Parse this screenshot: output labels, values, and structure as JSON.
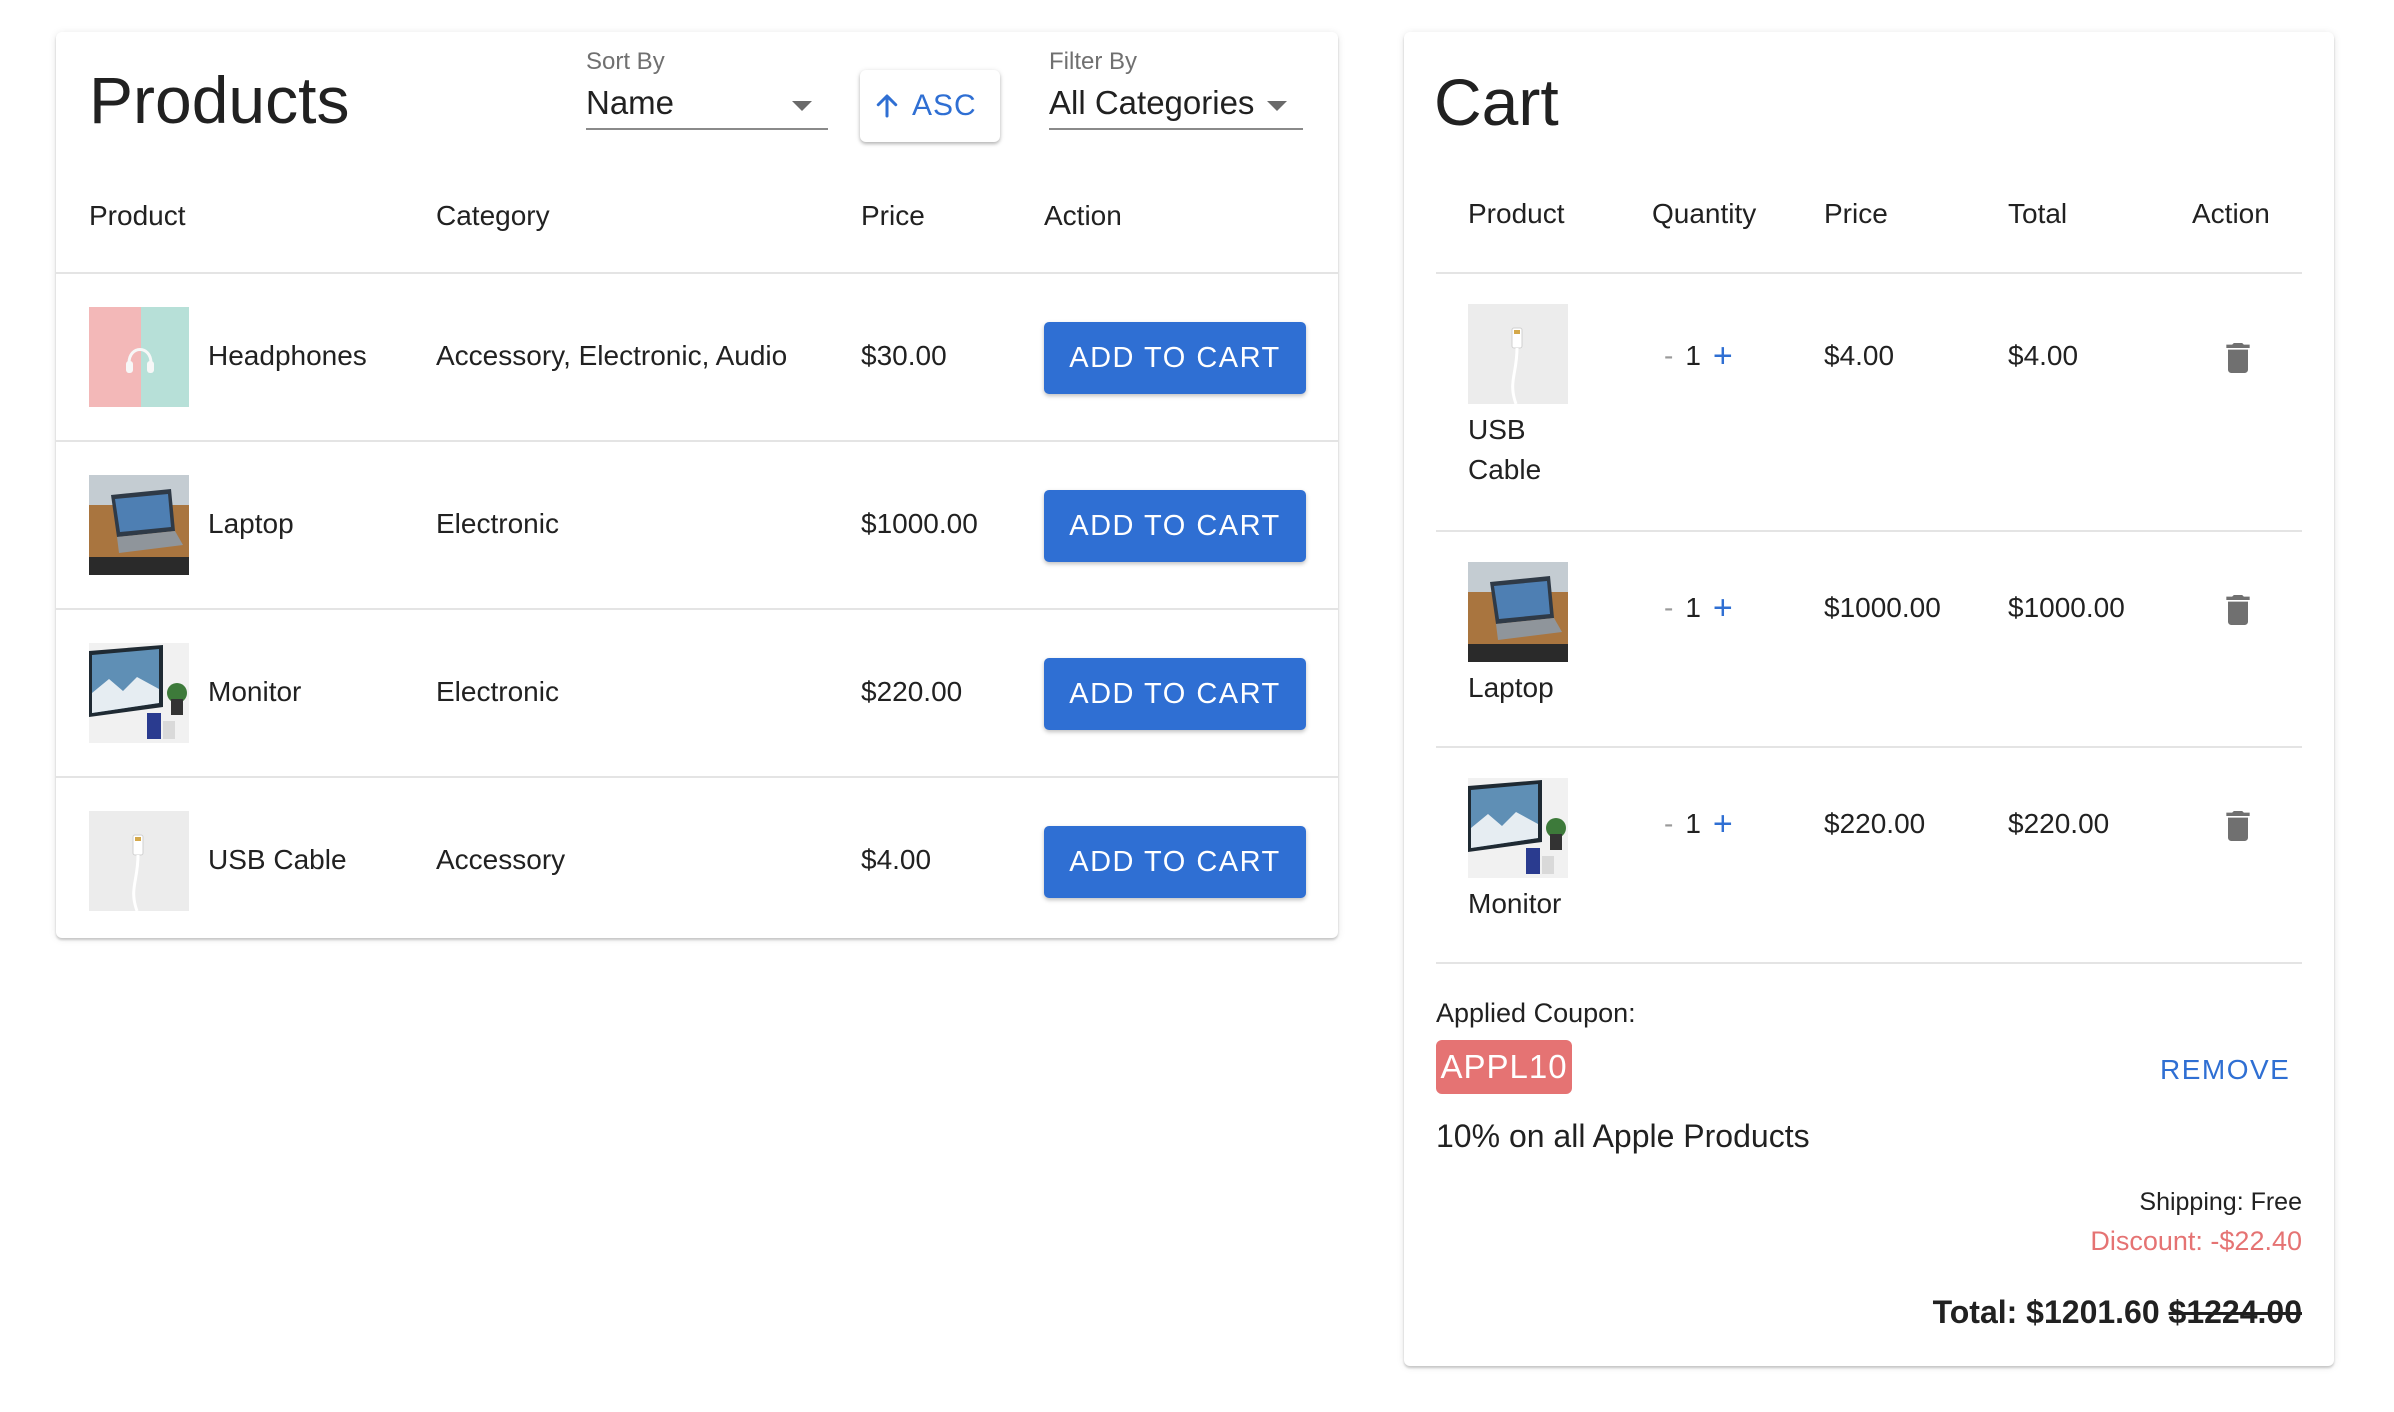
{
  "products": {
    "title": "Products",
    "sort": {
      "label": "Sort By",
      "value": "Name",
      "direction": "ASC"
    },
    "filter": {
      "label": "Filter By",
      "value": "All Categories"
    },
    "columns": [
      "Product",
      "Category",
      "Price",
      "Action"
    ],
    "rows": [
      {
        "name": "Headphones",
        "category": "Accessory, Electronic, Audio",
        "price": "$30.00",
        "action": "ADD TO CART",
        "thumb": "headphones"
      },
      {
        "name": "Laptop",
        "category": "Electronic",
        "price": "$1000.00",
        "action": "ADD TO CART",
        "thumb": "laptop"
      },
      {
        "name": "Monitor",
        "category": "Electronic",
        "price": "$220.00",
        "action": "ADD TO CART",
        "thumb": "monitor"
      },
      {
        "name": "USB Cable",
        "category": "Accessory",
        "price": "$4.00",
        "action": "ADD TO CART",
        "thumb": "usb"
      }
    ]
  },
  "cart": {
    "title": "Cart",
    "columns": [
      "Product",
      "Quantity",
      "Price",
      "Total",
      "Action"
    ],
    "items": [
      {
        "name_line1": "USB",
        "name_line2": "Cable",
        "quantity": "1",
        "price": "$4.00",
        "total": "$4.00",
        "thumb": "usb"
      },
      {
        "name_line1": "Laptop",
        "name_line2": "",
        "quantity": "1",
        "price": "$1000.00",
        "total": "$1000.00",
        "thumb": "laptop"
      },
      {
        "name_line1": "Monitor",
        "name_line2": "",
        "quantity": "1",
        "price": "$220.00",
        "total": "$220.00",
        "thumb": "monitor"
      }
    ],
    "qty_minus": "-",
    "qty_plus": "+",
    "coupon": {
      "label": "Applied Coupon:",
      "code": "APPL10",
      "description": "10% on all Apple Products",
      "remove_label": "REMOVE"
    },
    "shipping": "Shipping: Free",
    "discount": "Discount: -$22.40",
    "total_label": "Total: $1201.60",
    "total_original": "$1224.00"
  },
  "colors": {
    "accent": "#2f6fd3",
    "coupon": "#e57373",
    "divider": "#e4e4e4"
  }
}
